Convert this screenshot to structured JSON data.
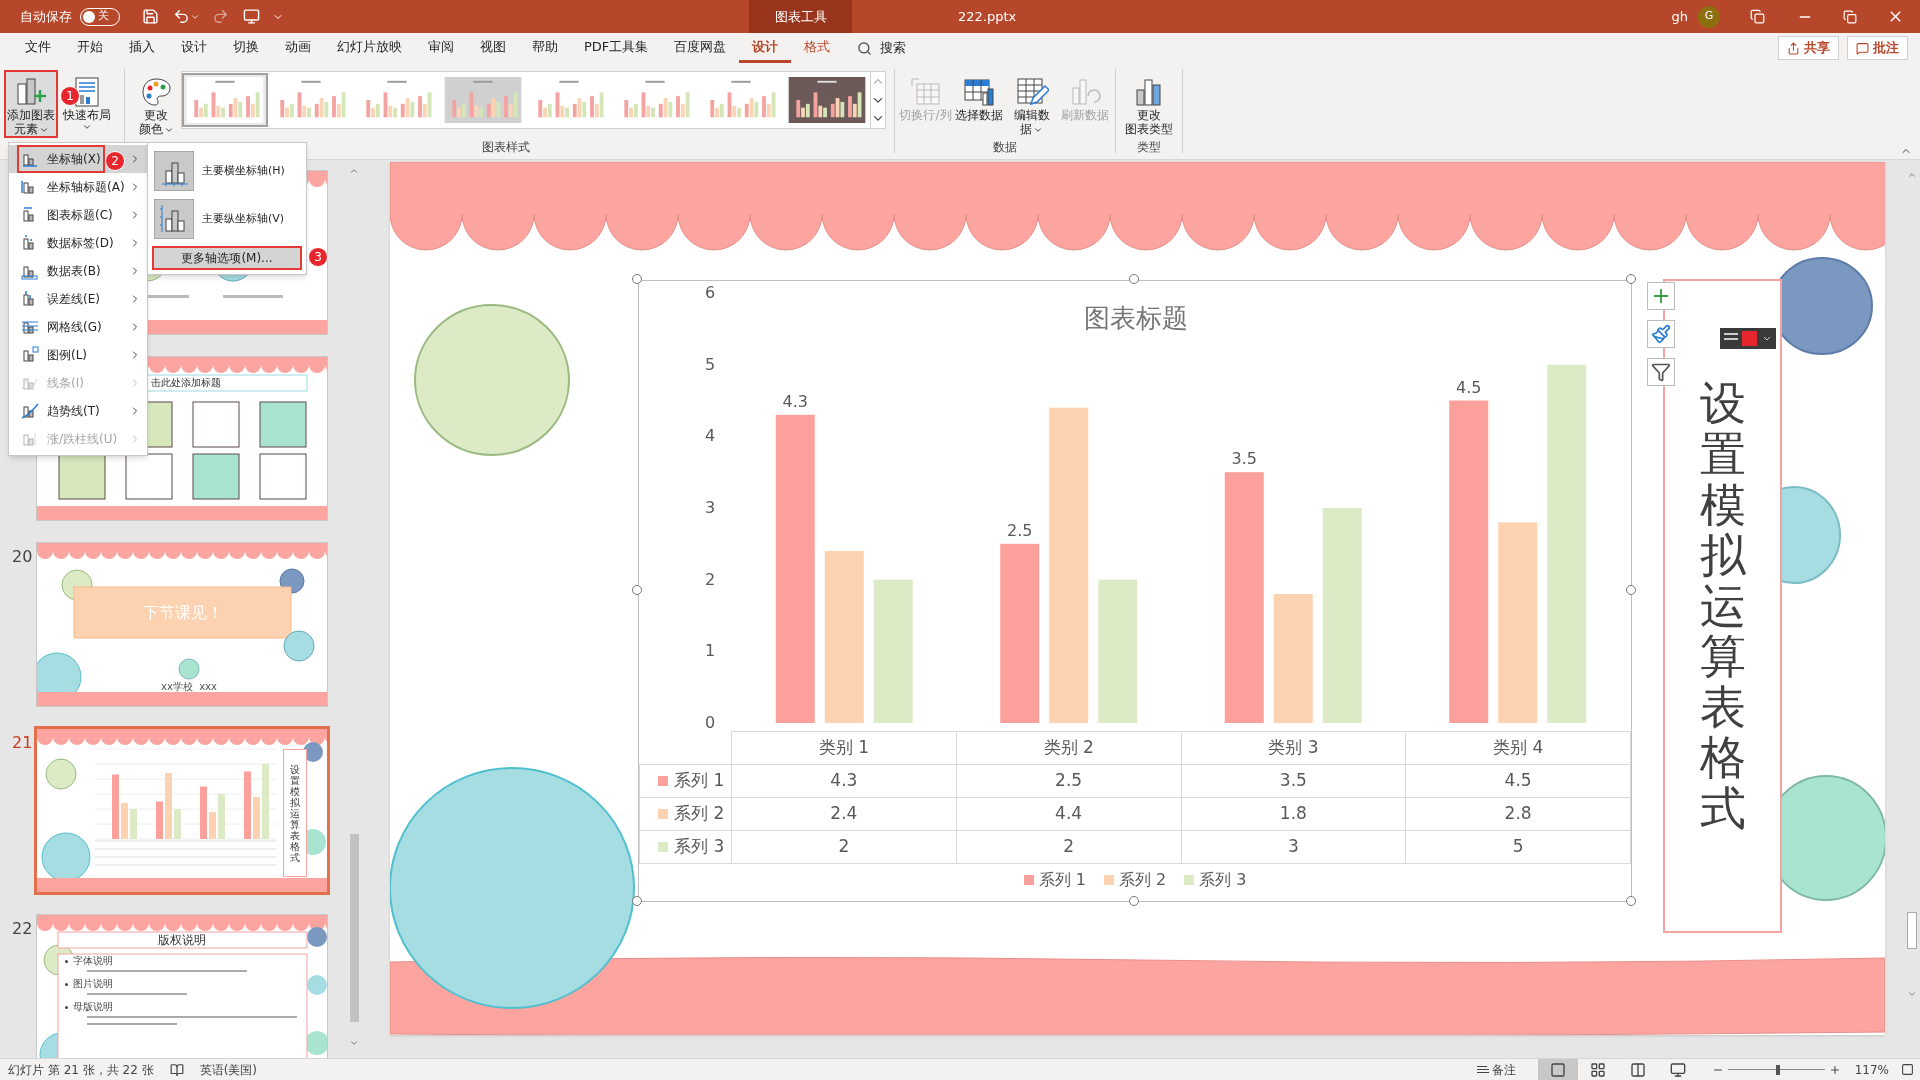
{
  "title_bar": {
    "autosave_label": "自动保存",
    "autosave": {
      "on": false,
      "label": "关"
    },
    "context_header": "图表工具",
    "file_name": "222.pptx",
    "user": "gh",
    "avatar": "G"
  },
  "ribbon_tabs": [
    {
      "label": "文件",
      "kind": "normal",
      "selected": false
    },
    {
      "label": "开始",
      "kind": "normal",
      "selected": false
    },
    {
      "label": "插入",
      "kind": "normal",
      "selected": false
    },
    {
      "label": "设计",
      "kind": "normal",
      "selected": false
    },
    {
      "label": "切换",
      "kind": "normal",
      "selected": false
    },
    {
      "label": "动画",
      "kind": "normal",
      "selected": false
    },
    {
      "label": "幻灯片放映",
      "kind": "normal",
      "selected": false
    },
    {
      "label": "审阅",
      "kind": "normal",
      "selected": false
    },
    {
      "label": "视图",
      "kind": "normal",
      "selected": false
    },
    {
      "label": "帮助",
      "kind": "normal",
      "selected": false
    },
    {
      "label": "PDF工具集",
      "kind": "normal",
      "selected": false
    },
    {
      "label": "百度网盘",
      "kind": "normal",
      "selected": false
    },
    {
      "label": "设计",
      "kind": "context",
      "selected": true
    },
    {
      "label": "格式",
      "kind": "context",
      "selected": false
    }
  ],
  "search": {
    "label": "搜索"
  },
  "header_buttons": [
    {
      "label": "共享",
      "kind": "share"
    },
    {
      "label": "批注",
      "kind": "comment"
    }
  ],
  "ribbon": {
    "layout_buttons": [
      {
        "lines": [
          "添加图表",
          "元素"
        ],
        "kind": "add_element",
        "caret": true,
        "highlighted": true,
        "callout": "1"
      },
      {
        "lines": [
          "快速布局"
        ],
        "kind": "quick_layout",
        "caret": true,
        "highlighted": false
      }
    ],
    "styles_group": {
      "label": "图表样式",
      "color_button": {
        "lines": [
          "更改",
          "颜色"
        ],
        "kind": "change_colors",
        "caret": true
      },
      "styles": [
        {
          "kind": "light",
          "selected": true
        },
        {
          "kind": "light",
          "selected": false
        },
        {
          "kind": "light",
          "selected": false
        },
        {
          "kind": "gray",
          "selected": false
        },
        {
          "kind": "light",
          "selected": false
        },
        {
          "kind": "light",
          "selected": false
        },
        {
          "kind": "light",
          "selected": false
        },
        {
          "kind": "dark",
          "selected": false
        }
      ]
    },
    "data_group": {
      "label": "数据",
      "buttons": [
        {
          "lines": [
            "切换行/列"
          ],
          "kind": "switch_row_col",
          "disabled": true,
          "caret": false
        },
        {
          "lines": [
            "选择数据"
          ],
          "kind": "select_data",
          "disabled": false,
          "caret": false
        },
        {
          "lines": [
            "编辑数",
            "据"
          ],
          "kind": "edit_data",
          "disabled": false,
          "caret": true
        },
        {
          "lines": [
            "刷新数据"
          ],
          "kind": "refresh_data",
          "disabled": true,
          "caret": false
        }
      ]
    },
    "type_group": {
      "label": "类型",
      "buttons": [
        {
          "lines": [
            "更改",
            "图表类型"
          ],
          "kind": "change_type",
          "disabled": false,
          "caret": false
        }
      ]
    }
  },
  "chart_element_menu": {
    "items": [
      {
        "label": "坐标轴(X)",
        "kind": "axes",
        "selected": true,
        "disabled": false,
        "callout": "2"
      },
      {
        "label": "坐标轴标题(A)",
        "kind": "axis_titles",
        "selected": false,
        "disabled": false
      },
      {
        "label": "图表标题(C)",
        "kind": "chart_title",
        "selected": false,
        "disabled": false
      },
      {
        "label": "数据标签(D)",
        "kind": "data_labels",
        "selected": false,
        "disabled": false
      },
      {
        "label": "数据表(B)",
        "kind": "data_table",
        "selected": false,
        "disabled": false
      },
      {
        "label": "误差线(E)",
        "kind": "error_bars",
        "selected": false,
        "disabled": false
      },
      {
        "label": "网格线(G)",
        "kind": "gridlines",
        "selected": false,
        "disabled": false
      },
      {
        "label": "图例(L)",
        "kind": "legend",
        "selected": false,
        "disabled": false
      },
      {
        "label": "线条(I)",
        "kind": "lines",
        "selected": false,
        "disabled": true
      },
      {
        "label": "趋势线(T)",
        "kind": "trendline",
        "selected": false,
        "disabled": false
      },
      {
        "label": "涨/跌柱线(U)",
        "kind": "updown_bars",
        "selected": false,
        "disabled": true
      }
    ],
    "submenu": {
      "items": [
        {
          "label": "主要横坐标轴(H)",
          "kind": "horizontal"
        },
        {
          "label": "主要纵坐标轴(V)",
          "kind": "vertical"
        }
      ],
      "more_button": {
        "label": "更多轴选项(M)...",
        "callout": "3"
      }
    }
  },
  "slide_thumbnails": [
    {
      "kind": "cards",
      "selected": false
    },
    {
      "kind": "grid",
      "selected": false,
      "title": "击此处添加标题"
    },
    {
      "kind": "ending",
      "number": "20",
      "selected": false,
      "title": "下节课见！",
      "footer": "xx学校  xxx"
    },
    {
      "kind": "chart",
      "number": "21",
      "selected": true,
      "vertical_title": "设置模拟运算表格式"
    },
    {
      "kind": "copyright",
      "number": "22",
      "selected": false,
      "title": "版权说明",
      "bullets": [
        "字体说明",
        "图片说明",
        "母版说明"
      ]
    }
  ],
  "slide": {
    "chart": {
      "chart_data": {
        "type": "bar",
        "title": "图表标题",
        "legend": true,
        "categories": [
          "类别 1",
          "类别 2",
          "类别 3",
          "类别 4"
        ],
        "ylim": [
          0,
          6
        ],
        "yticks": [
          0,
          1,
          2,
          3,
          4,
          5,
          6
        ],
        "series": [
          {
            "name": "系列 1",
            "color": "#fca09b",
            "values": [
              4.3,
              2.5,
              3.5,
              4.5
            ],
            "value_labels": [
              "4.3",
              "2.5",
              "3.5",
              "4.5"
            ]
          },
          {
            "name": "系列 2",
            "color": "#fdd2b1",
            "values": [
              2.4,
              4.4,
              1.8,
              2.8
            ]
          },
          {
            "name": "系列 3",
            "color": "#dcebc5",
            "values": [
              2,
              2,
              3,
              5
            ]
          }
        ]
      },
      "data_table": {
        "rows": [
          {
            "series": "系列 1",
            "color": "#fca09b",
            "cells": [
              "4.3",
              "2.5",
              "3.5",
              "4.5"
            ]
          },
          {
            "series": "系列 2",
            "color": "#fdd2b1",
            "cells": [
              "2.4",
              "4.4",
              "1.8",
              "2.8"
            ]
          },
          {
            "series": "系列 3",
            "color": "#dcebc5",
            "cells": [
              "2",
              "2",
              "3",
              "5"
            ]
          }
        ]
      }
    },
    "side_buttons": [
      {
        "kind": "add"
      },
      {
        "kind": "style"
      },
      {
        "kind": "filter"
      }
    ],
    "vertical_title": "设置模拟运算表格式"
  },
  "status_bar": {
    "slide_info": "幻灯片 第 21 张，共 22 张",
    "language": "英语(美国)",
    "notes": "备注",
    "views": [
      {
        "kind": "normal",
        "selected": true
      },
      {
        "kind": "sorter",
        "selected": false
      },
      {
        "kind": "reading",
        "selected": false
      },
      {
        "kind": "slideshow",
        "selected": false
      }
    ],
    "zoom": {
      "level": 0.52,
      "reading": "117%"
    }
  }
}
